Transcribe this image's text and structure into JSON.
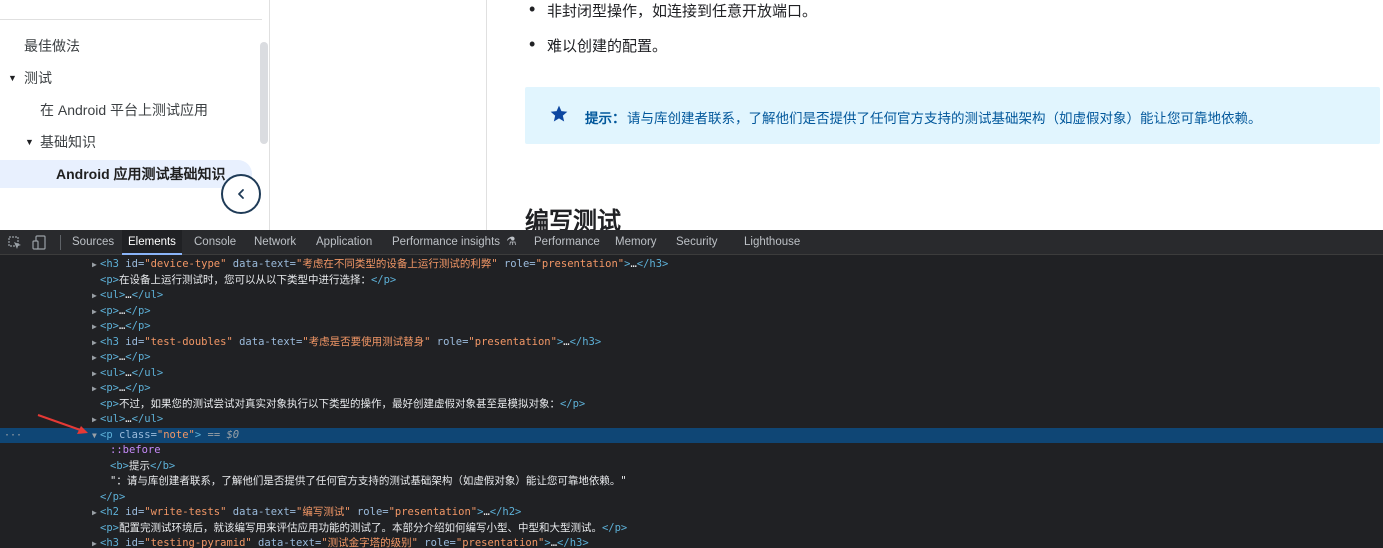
{
  "sidebar": {
    "items": [
      {
        "label": "最佳做法",
        "expanded": null,
        "active": false
      },
      {
        "label": "测试",
        "expanded": true,
        "active": false
      },
      {
        "label": "在 Android 平台上测试应用",
        "expanded": null,
        "active": false
      },
      {
        "label": "基础知识",
        "expanded": true,
        "active": false
      },
      {
        "label": "Android 应用测试基础知识",
        "expanded": null,
        "active": true
      }
    ],
    "collapse_icon": "chevron-left-icon"
  },
  "content": {
    "bullets": [
      "非封闭型操作，如连接到任意开放端口。",
      "难以创建的配置。"
    ],
    "note_label": "提示：",
    "note_text": "请与库创建者联系，了解他们是否提供了任何官方支持的测试基础架构（如虚假对象）能让您可靠地依赖。",
    "heading": "编写测试",
    "note_color": "#01579b",
    "note_bg": "#e1f5fe"
  },
  "devtools": {
    "tabs": [
      {
        "label": "Sources",
        "active": false
      },
      {
        "label": "Elements",
        "active": true
      },
      {
        "label": "Console",
        "active": false
      },
      {
        "label": "Network",
        "active": false
      },
      {
        "label": "Application",
        "active": false
      },
      {
        "label": "Performance insights",
        "active": false
      },
      {
        "label": "Performance",
        "active": false
      },
      {
        "label": "Memory",
        "active": false
      },
      {
        "label": "Security",
        "active": false
      },
      {
        "label": "Lighthouse",
        "active": false
      }
    ],
    "flask_icon": "⚗",
    "lines": [
      {
        "indent": 0,
        "tri": "▶",
        "parts": [
          [
            "t",
            "<h3 "
          ],
          [
            "an",
            "id="
          ],
          [
            "av",
            "\"device-type\""
          ],
          [
            "an",
            " data-text="
          ],
          [
            "av",
            "\"考虑在不同类型的设备上运行测试的利弊\""
          ],
          [
            "an",
            " role="
          ],
          [
            "av",
            "\"presentation\""
          ],
          [
            "t",
            ">"
          ],
          [
            "tx",
            "…"
          ],
          [
            "t",
            "</h3>"
          ]
        ]
      },
      {
        "indent": 0,
        "tri": "",
        "parts": [
          [
            "t",
            "<p>"
          ],
          [
            "tx",
            "在设备上运行测试时，您可以从以下类型中进行选择："
          ],
          [
            "t",
            "</p>"
          ]
        ]
      },
      {
        "indent": 0,
        "tri": "▶",
        "parts": [
          [
            "t",
            "<ul>"
          ],
          [
            "tx",
            "…"
          ],
          [
            "t",
            "</ul>"
          ]
        ]
      },
      {
        "indent": 0,
        "tri": "▶",
        "parts": [
          [
            "t",
            "<p>"
          ],
          [
            "tx",
            "…"
          ],
          [
            "t",
            "</p>"
          ]
        ]
      },
      {
        "indent": 0,
        "tri": "▶",
        "parts": [
          [
            "t",
            "<p>"
          ],
          [
            "tx",
            "…"
          ],
          [
            "t",
            "</p>"
          ]
        ]
      },
      {
        "indent": 0,
        "tri": "▶",
        "parts": [
          [
            "t",
            "<h3 "
          ],
          [
            "an",
            "id="
          ],
          [
            "av",
            "\"test-doubles\""
          ],
          [
            "an",
            " data-text="
          ],
          [
            "av",
            "\"考虑是否要使用测试替身\""
          ],
          [
            "an",
            " role="
          ],
          [
            "av",
            "\"presentation\""
          ],
          [
            "t",
            ">"
          ],
          [
            "tx",
            "…"
          ],
          [
            "t",
            "</h3>"
          ]
        ]
      },
      {
        "indent": 0,
        "tri": "▶",
        "parts": [
          [
            "t",
            "<p>"
          ],
          [
            "tx",
            "…"
          ],
          [
            "t",
            "</p>"
          ]
        ]
      },
      {
        "indent": 0,
        "tri": "▶",
        "parts": [
          [
            "t",
            "<ul>"
          ],
          [
            "tx",
            "…"
          ],
          [
            "t",
            "</ul>"
          ]
        ]
      },
      {
        "indent": 0,
        "tri": "▶",
        "parts": [
          [
            "t",
            "<p>"
          ],
          [
            "tx",
            "…"
          ],
          [
            "t",
            "</p>"
          ]
        ]
      },
      {
        "indent": 0,
        "tri": "",
        "parts": [
          [
            "t",
            "<p>"
          ],
          [
            "tx",
            "不过，如果您的测试尝试对真实对象执行以下类型的操作，最好创建虚假对象甚至是模拟对象："
          ],
          [
            "t",
            "</p>"
          ]
        ]
      },
      {
        "indent": 0,
        "tri": "▶",
        "parts": [
          [
            "t",
            "<ul>"
          ],
          [
            "tx",
            "…"
          ],
          [
            "t",
            "</ul>"
          ]
        ]
      },
      {
        "indent": 0,
        "tri": "▼",
        "selected": true,
        "parts": [
          [
            "t",
            "<p "
          ],
          [
            "an",
            "class="
          ],
          [
            "av",
            "\"note\""
          ],
          [
            "t",
            ">"
          ],
          [
            "eq",
            " == $0"
          ]
        ]
      },
      {
        "indent": 1,
        "tri": "",
        "parts": [
          [
            "ps",
            "::before"
          ]
        ]
      },
      {
        "indent": 1,
        "tri": "",
        "parts": [
          [
            "t",
            "<b>"
          ],
          [
            "tx",
            "提示"
          ],
          [
            "t",
            "</b>"
          ]
        ]
      },
      {
        "indent": 1,
        "tri": "",
        "parts": [
          [
            "tx",
            "\"：请与库创建者联系，了解他们是否提供了任何官方支持的测试基础架构（如虚假对象）能让您可靠地依赖。\""
          ]
        ]
      },
      {
        "indent": 0,
        "tri": "",
        "parts": [
          [
            "t",
            "</p>"
          ]
        ]
      },
      {
        "indent": 0,
        "tri": "▶",
        "parts": [
          [
            "t",
            "<h2 "
          ],
          [
            "an",
            "id="
          ],
          [
            "av",
            "\"write-tests\""
          ],
          [
            "an",
            " data-text="
          ],
          [
            "av",
            "\"编写测试\""
          ],
          [
            "an",
            " role="
          ],
          [
            "av",
            "\"presentation\""
          ],
          [
            "t",
            ">"
          ],
          [
            "tx",
            "…"
          ],
          [
            "t",
            "</h2>"
          ]
        ]
      },
      {
        "indent": 0,
        "tri": "",
        "parts": [
          [
            "t",
            "<p>"
          ],
          [
            "tx",
            "配置完测试环境后，就该编写用来评估应用功能的测试了。本部分介绍如何编写小型、中型和大型测试。"
          ],
          [
            "t",
            "</p>"
          ]
        ]
      },
      {
        "indent": 0,
        "tri": "▶",
        "parts": [
          [
            "t",
            "<h3 "
          ],
          [
            "an",
            "id="
          ],
          [
            "av",
            "\"testing-pyramid\""
          ],
          [
            "an",
            " data-text="
          ],
          [
            "av",
            "\"测试金字塔的级别\""
          ],
          [
            "an",
            " role="
          ],
          [
            "av",
            "\"presentation\""
          ],
          [
            "t",
            ">"
          ],
          [
            "tx",
            "…"
          ],
          [
            "t",
            "</h3>"
          ]
        ]
      }
    ],
    "selected_dots": "···"
  }
}
